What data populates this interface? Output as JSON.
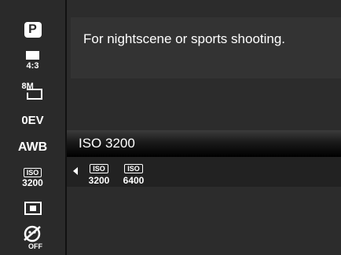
{
  "sidebar": {
    "items": [
      {
        "name": "program-mode",
        "label": "P"
      },
      {
        "name": "aspect-ratio",
        "label": "4:3"
      },
      {
        "name": "image-size",
        "label": "8M"
      },
      {
        "name": "exposure-compensation",
        "label": "0EV"
      },
      {
        "name": "white-balance",
        "label": "AWB"
      },
      {
        "name": "iso",
        "tag": "ISO",
        "value": "3200"
      },
      {
        "name": "metering",
        "label": ""
      },
      {
        "name": "face-detection-off",
        "label": "OFF"
      }
    ]
  },
  "help": {
    "text": "For nightscene or sports shooting."
  },
  "selection": {
    "current": "ISO 3200"
  },
  "options": [
    {
      "tag": "ISO",
      "value": "3200"
    },
    {
      "tag": "ISO",
      "value": "6400"
    }
  ]
}
